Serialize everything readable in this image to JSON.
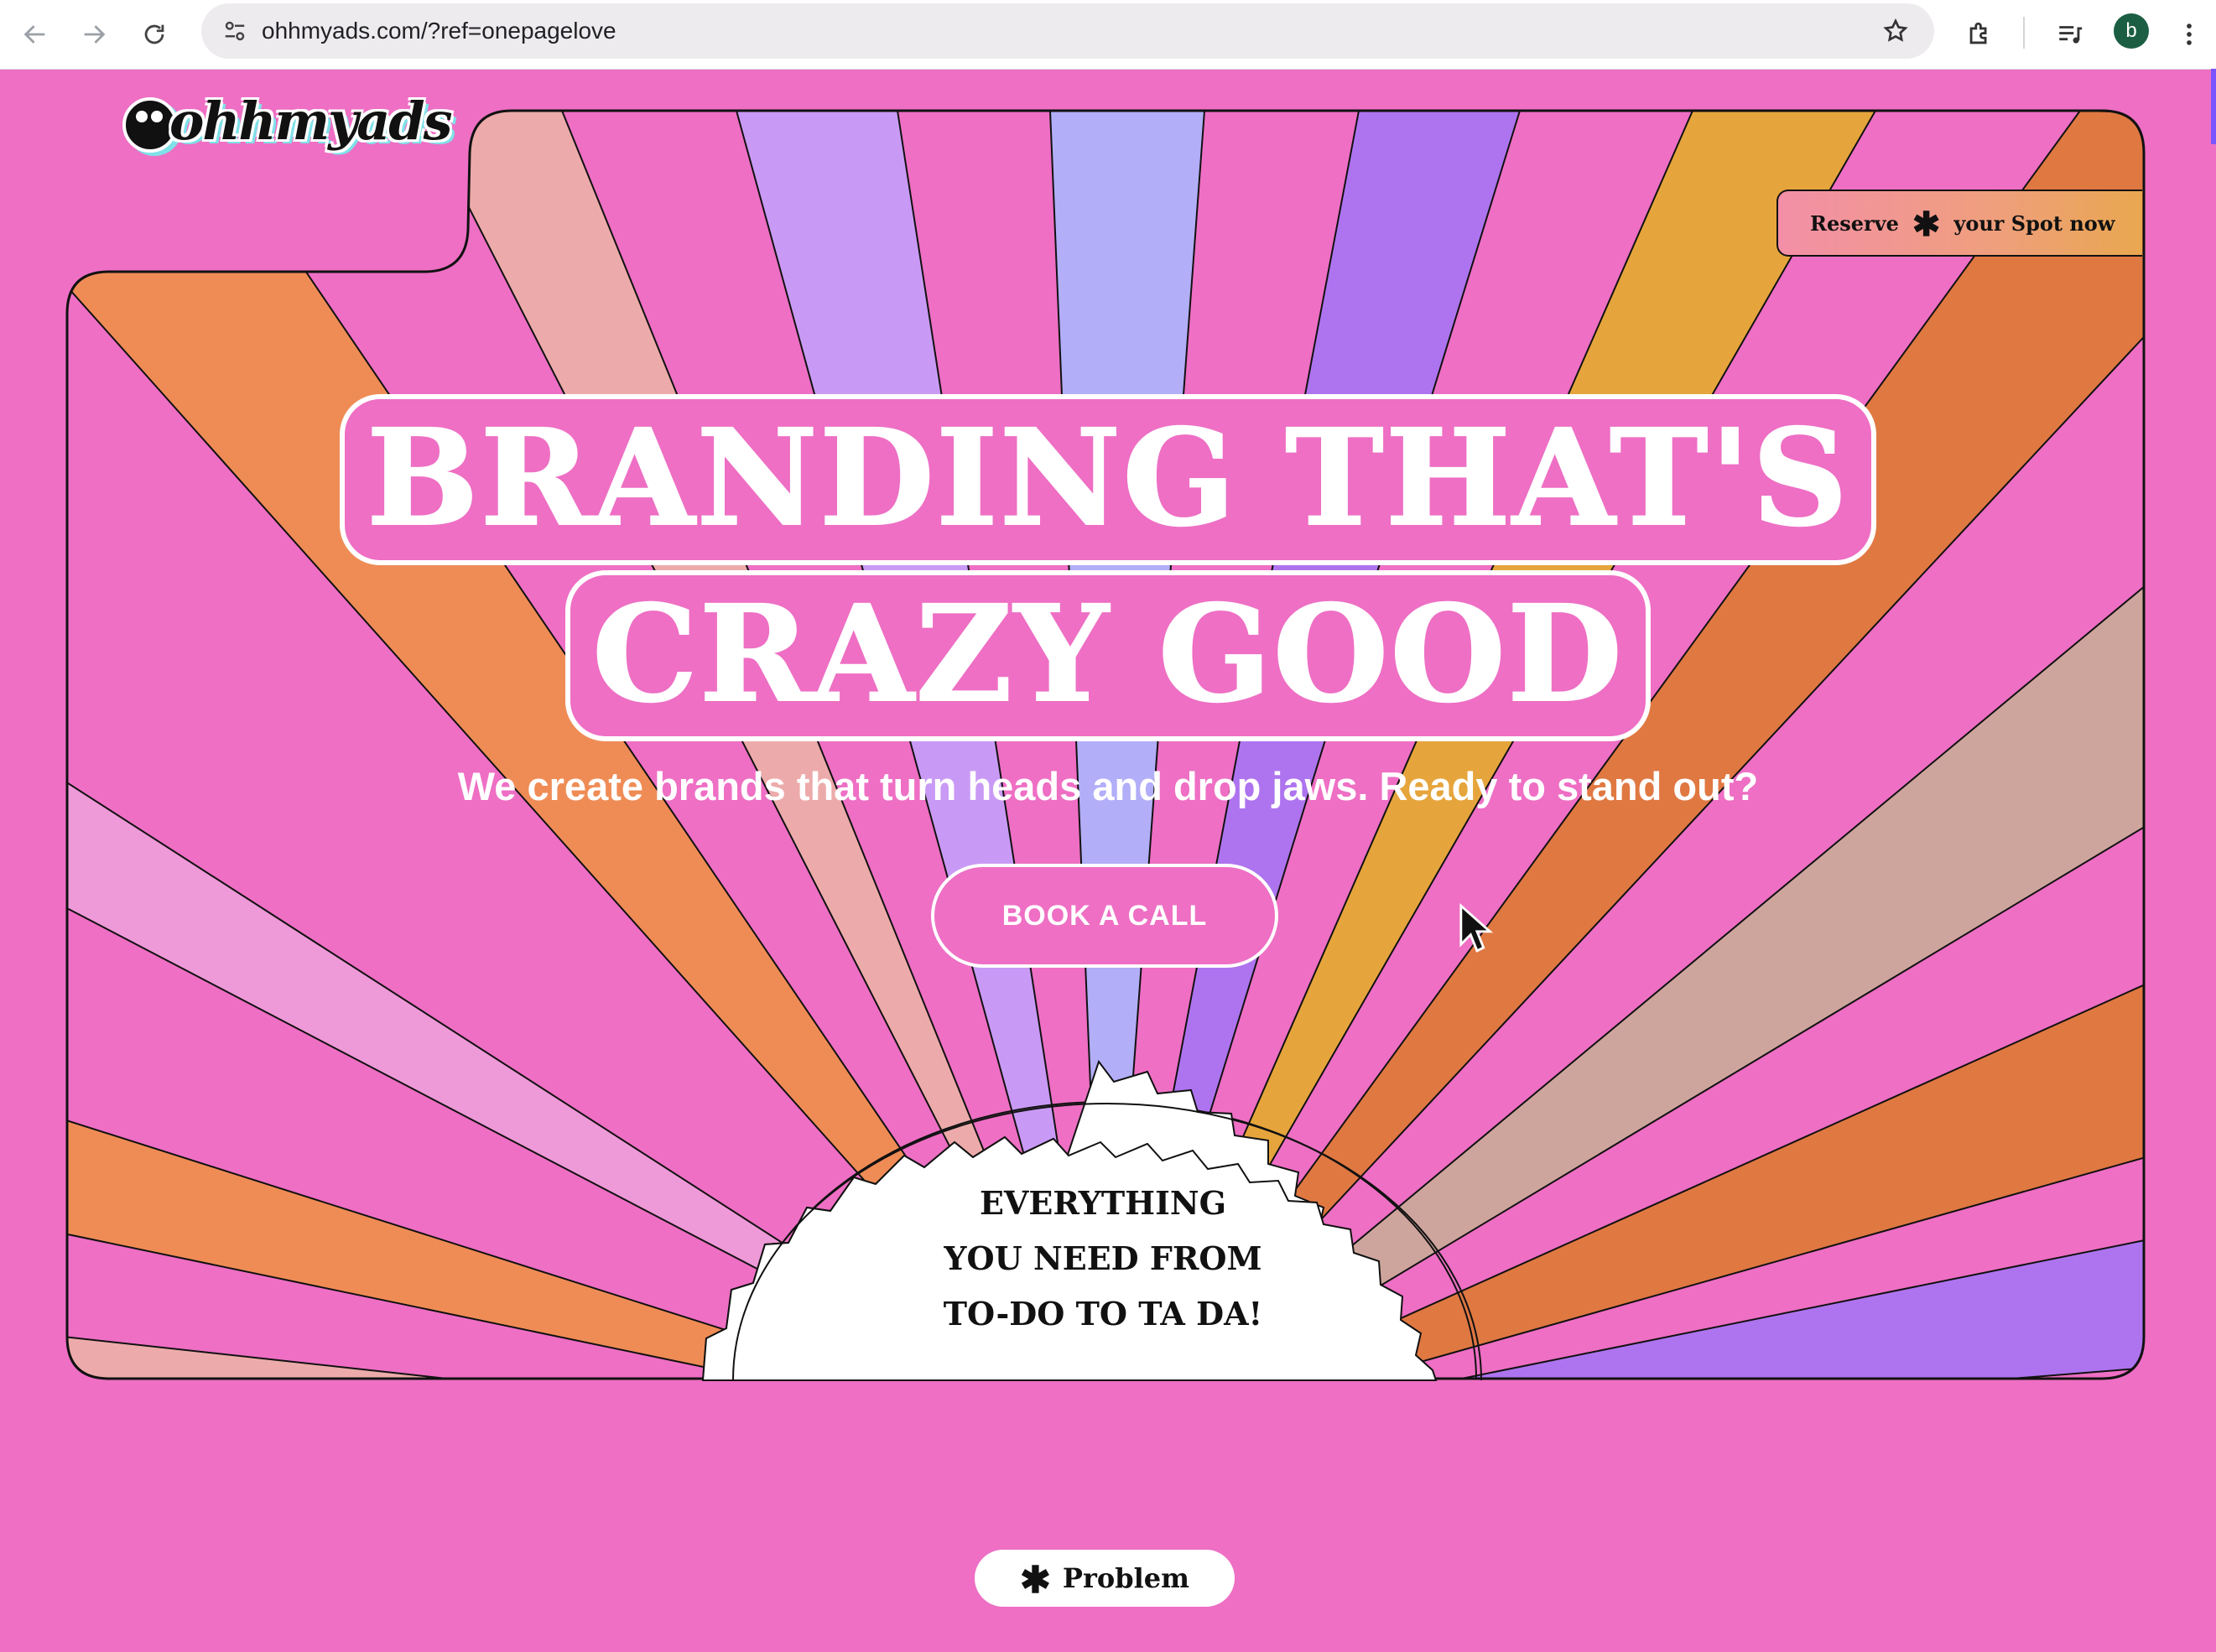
{
  "browser": {
    "url": "ohhmyads.com/?ref=onepagelove",
    "profile_initial": "b"
  },
  "logo": {
    "text": "ohhmyads"
  },
  "header": {
    "reserve_left": "Reserve",
    "reserve_right": "your Spot now",
    "reserve_icon": "asterisk-icon"
  },
  "hero": {
    "headline_line1": "BRANDING THAT'S",
    "headline_line2": "CRAZY GOOD",
    "subline": "We create brands that turn heads and drop jaws. Ready to stand out?",
    "cta_label": "BOOK A CALL",
    "badge_lines": [
      "EVERYTHING",
      "YOU NEED FROM",
      "TO-DO TO TA DA!"
    ]
  },
  "section_pill": {
    "label": "Problem",
    "icon": "asterisk-icon"
  },
  "colors": {
    "background": "#ee6fc4",
    "ray_orange": "#ef8c56",
    "ray_peach": "#ecabaa",
    "ray_lavender": "#c99af5",
    "ray_periwinkle": "#b2aef8",
    "ray_purple": "#ae74ef",
    "ray_gold": "#e6a53c",
    "ray_burnt": "#e07842",
    "ray_taupe": "#cea59d",
    "ray_lightpink": "#ee99d8"
  }
}
